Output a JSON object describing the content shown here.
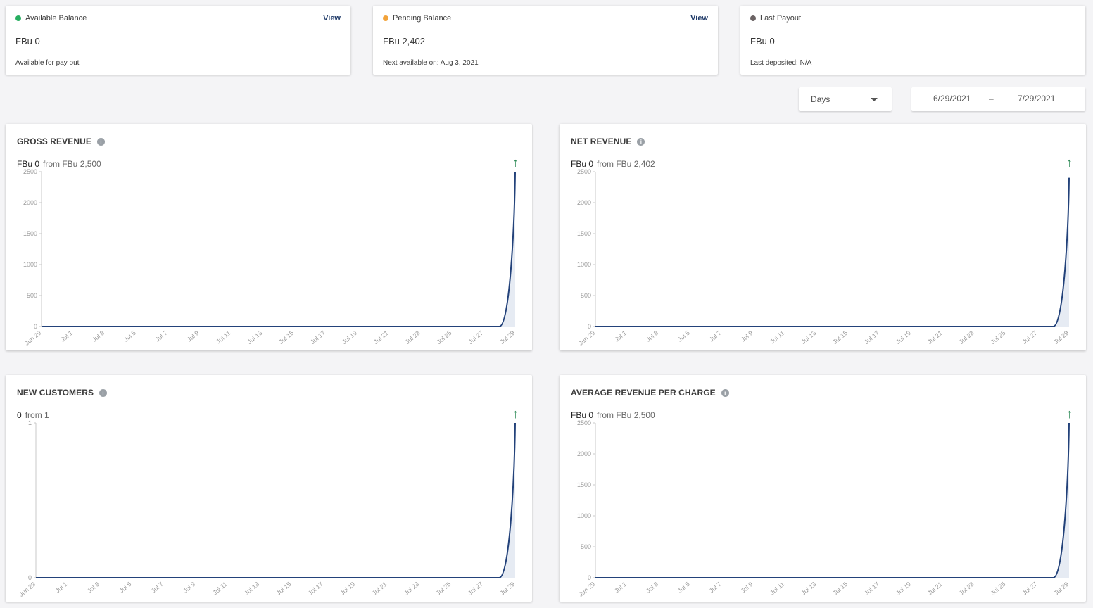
{
  "balances": [
    {
      "title": "Available Balance",
      "dot_color": "#27ae60",
      "amount": "FBu 0",
      "sub": "Available for pay out",
      "view_label": "View"
    },
    {
      "title": "Pending Balance",
      "dot_color": "#f2a33a",
      "amount": "FBu 2,402",
      "sub": "Next available on: Aug 3, 2021",
      "view_label": "View"
    },
    {
      "title": "Last Payout",
      "dot_color": "#6b6364",
      "amount": "FBu 0",
      "sub": "Last deposited: N/A",
      "view_label": ""
    }
  ],
  "period_select": {
    "value": "Days"
  },
  "date_range": {
    "start": "6/29/2021",
    "separator": "–",
    "end": "7/29/2021"
  },
  "x_tick_labels": [
    "Jun 29",
    "Jul 1",
    "Jul 3",
    "Jul 5",
    "Jul 7",
    "Jul 9",
    "Jul 11",
    "Jul 13",
    "Jul 15",
    "Jul 17",
    "Jul 19",
    "Jul 21",
    "Jul 23",
    "Jul 25",
    "Jul 27",
    "Jul 29"
  ],
  "colors": {
    "line": "#23427a",
    "area": "#e6ebf3",
    "trend_up": "#2e8b57"
  },
  "charts": [
    {
      "title": "GROSS REVENUE",
      "current": "FBu 0",
      "previous": "from FBu 2,500",
      "trend_icon": "↑",
      "yticks": [
        "0",
        "500",
        "1000",
        "1500",
        "2000",
        "2500"
      ]
    },
    {
      "title": "NET REVENUE",
      "current": "FBu 0",
      "previous": "from FBu 2,402",
      "trend_icon": "↑",
      "yticks": [
        "0",
        "500",
        "1000",
        "1500",
        "2000",
        "2500"
      ]
    },
    {
      "title": "NEW CUSTOMERS",
      "current": "0",
      "previous": "from 1",
      "trend_icon": "↑",
      "yticks": [
        "0",
        "1"
      ]
    },
    {
      "title": "AVERAGE REVENUE PER CHARGE",
      "current": "FBu 0",
      "previous": "from FBu 2,500",
      "trend_icon": "↑",
      "yticks": [
        "0",
        "500",
        "1000",
        "1500",
        "2000",
        "2500"
      ]
    }
  ],
  "chart_data": [
    {
      "type": "area",
      "title": "GROSS REVENUE",
      "x_range": [
        "6/29/2021",
        "7/29/2021"
      ],
      "xlabels_every_other_day": true,
      "ylim": [
        0,
        2500
      ],
      "series": [
        {
          "values": [
            0,
            0,
            0,
            0,
            0,
            0,
            0,
            0,
            0,
            0,
            0,
            0,
            0,
            0,
            0,
            0,
            0,
            0,
            0,
            0,
            0,
            0,
            0,
            0,
            0,
            0,
            0,
            0,
            0,
            0,
            2500
          ]
        }
      ]
    },
    {
      "type": "area",
      "title": "NET REVENUE",
      "x_range": [
        "6/29/2021",
        "7/29/2021"
      ],
      "xlabels_every_other_day": true,
      "ylim": [
        0,
        2500
      ],
      "series": [
        {
          "values": [
            0,
            0,
            0,
            0,
            0,
            0,
            0,
            0,
            0,
            0,
            0,
            0,
            0,
            0,
            0,
            0,
            0,
            0,
            0,
            0,
            0,
            0,
            0,
            0,
            0,
            0,
            0,
            0,
            0,
            0,
            2402
          ]
        }
      ]
    },
    {
      "type": "area",
      "title": "NEW CUSTOMERS",
      "x_range": [
        "6/29/2021",
        "7/29/2021"
      ],
      "xlabels_every_other_day": true,
      "ylim": [
        0,
        1
      ],
      "series": [
        {
          "values": [
            0,
            0,
            0,
            0,
            0,
            0,
            0,
            0,
            0,
            0,
            0,
            0,
            0,
            0,
            0,
            0,
            0,
            0,
            0,
            0,
            0,
            0,
            0,
            0,
            0,
            0,
            0,
            0,
            0,
            0,
            1
          ]
        }
      ]
    },
    {
      "type": "area",
      "title": "AVERAGE REVENUE PER CHARGE",
      "x_range": [
        "6/29/2021",
        "7/29/2021"
      ],
      "xlabels_every_other_day": true,
      "ylim": [
        0,
        2500
      ],
      "series": [
        {
          "values": [
            0,
            0,
            0,
            0,
            0,
            0,
            0,
            0,
            0,
            0,
            0,
            0,
            0,
            0,
            0,
            0,
            0,
            0,
            0,
            0,
            0,
            0,
            0,
            0,
            0,
            0,
            0,
            0,
            0,
            0,
            2500
          ]
        }
      ]
    }
  ]
}
